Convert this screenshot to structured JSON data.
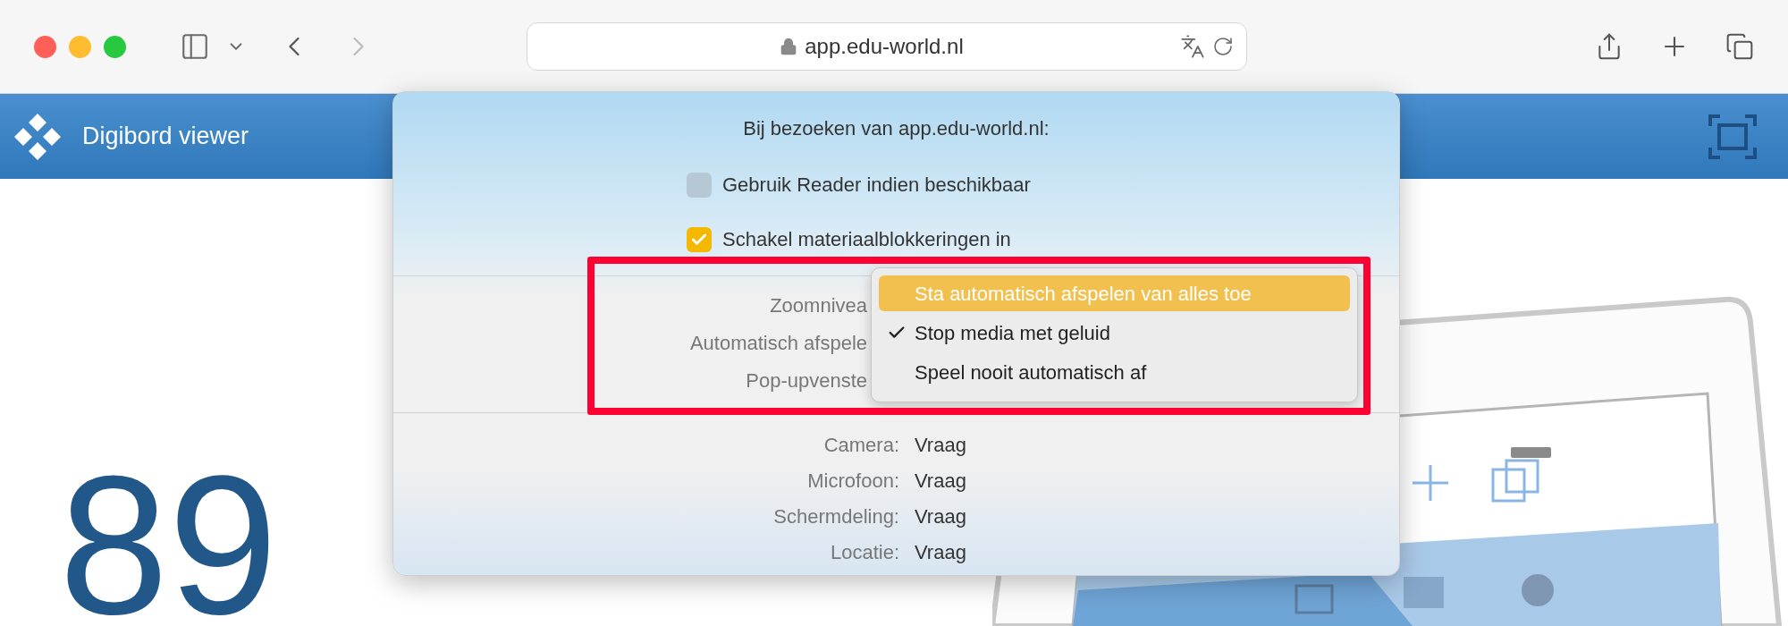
{
  "browser": {
    "url": "app.edu-world.nl"
  },
  "page": {
    "title": "Digibord viewer",
    "number": "89"
  },
  "popover": {
    "title": "Bij bezoeken van app.edu-world.nl:",
    "checkboxes": [
      {
        "label": "Gebruik Reader indien beschikbaar",
        "checked": false
      },
      {
        "label": "Schakel materiaalblokkeringen in",
        "checked": true
      }
    ],
    "settings": [
      "Zoomnivea",
      "Automatisch afspele",
      "Pop-upvenste"
    ],
    "menu": [
      {
        "label": "Sta automatisch afspelen van alles toe",
        "selected": true,
        "checked": false
      },
      {
        "label": "Stop media met geluid",
        "selected": false,
        "checked": true
      },
      {
        "label": "Speel nooit automatisch af",
        "selected": false,
        "checked": false
      }
    ],
    "permissions": [
      {
        "label": "Camera:",
        "value": "Vraag"
      },
      {
        "label": "Microfoon:",
        "value": "Vraag"
      },
      {
        "label": "Schermdeling:",
        "value": "Vraag"
      },
      {
        "label": "Locatie:",
        "value": "Vraag"
      }
    ]
  }
}
